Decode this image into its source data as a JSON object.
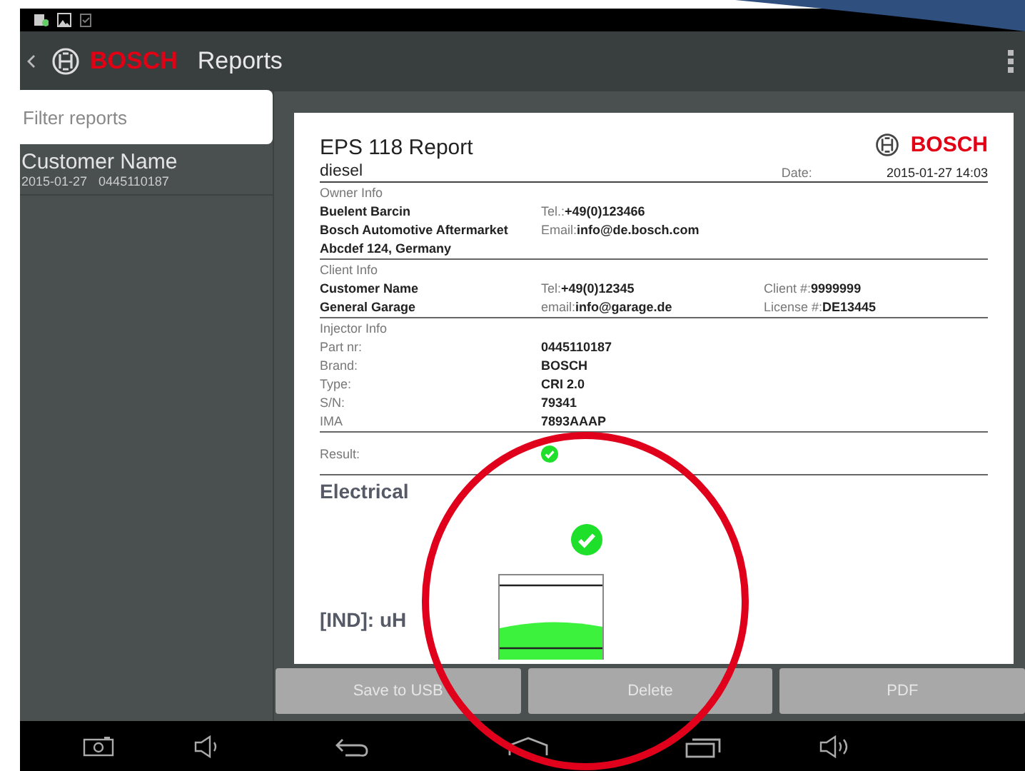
{
  "app_bar": {
    "brand": "BOSCH",
    "title": "Reports"
  },
  "sidebar": {
    "filter": {
      "placeholder": "Filter reports"
    },
    "items": [
      {
        "name": "Customer Name",
        "date": "2015-01-27",
        "part": "0445110187"
      }
    ]
  },
  "report": {
    "title": "EPS 118 Report",
    "brand": "BOSCH",
    "subtitle": "diesel",
    "date_label": "Date:",
    "date": "2015-01-27 14:03",
    "sections": [
      {
        "heading": "Owner Info",
        "rows": [
          [
            {
              "value": "Buelent Barcin"
            },
            {
              "label": "Tel.:",
              "value": "+49(0)123466"
            }
          ],
          [
            {
              "value": "Bosch Automotive Aftermarket"
            },
            {
              "label": "Email:",
              "value": "info@de.bosch.com"
            }
          ],
          [
            {
              "value": "Abcdef 124, Germany"
            }
          ]
        ]
      },
      {
        "heading": "Client Info",
        "rows": [
          [
            {
              "value": "Customer Name"
            },
            {
              "label": "Tel:",
              "value": "+49(0)12345"
            },
            {
              "label": "Client #:",
              "value": "9999999"
            }
          ],
          [
            {
              "value": "General Garage"
            },
            {
              "label": "email:",
              "value": "info@garage.de"
            },
            {
              "label": "License #:",
              "value": "DE13445"
            }
          ]
        ]
      },
      {
        "heading": "Injector Info",
        "rows": [
          [
            {
              "label": "Part nr:"
            },
            {
              "value": "0445110187"
            }
          ],
          [
            {
              "label": "Brand:"
            },
            {
              "value": "BOSCH"
            }
          ],
          [
            {
              "label": "Type:"
            },
            {
              "value": "CRI 2.0"
            }
          ],
          [
            {
              "label": "S/N:"
            },
            {
              "value": "79341"
            }
          ],
          [
            {
              "label": "IMA"
            },
            {
              "value": "7893AAAP"
            }
          ]
        ]
      }
    ],
    "result": {
      "label": "Result:",
      "passed": true
    },
    "electrical": {
      "heading": "Electrical",
      "passed": true,
      "measure_label": "[IND]: uH"
    }
  },
  "actions": [
    {
      "label": "Save to USB"
    },
    {
      "label": "Delete"
    },
    {
      "label": "PDF"
    }
  ]
}
